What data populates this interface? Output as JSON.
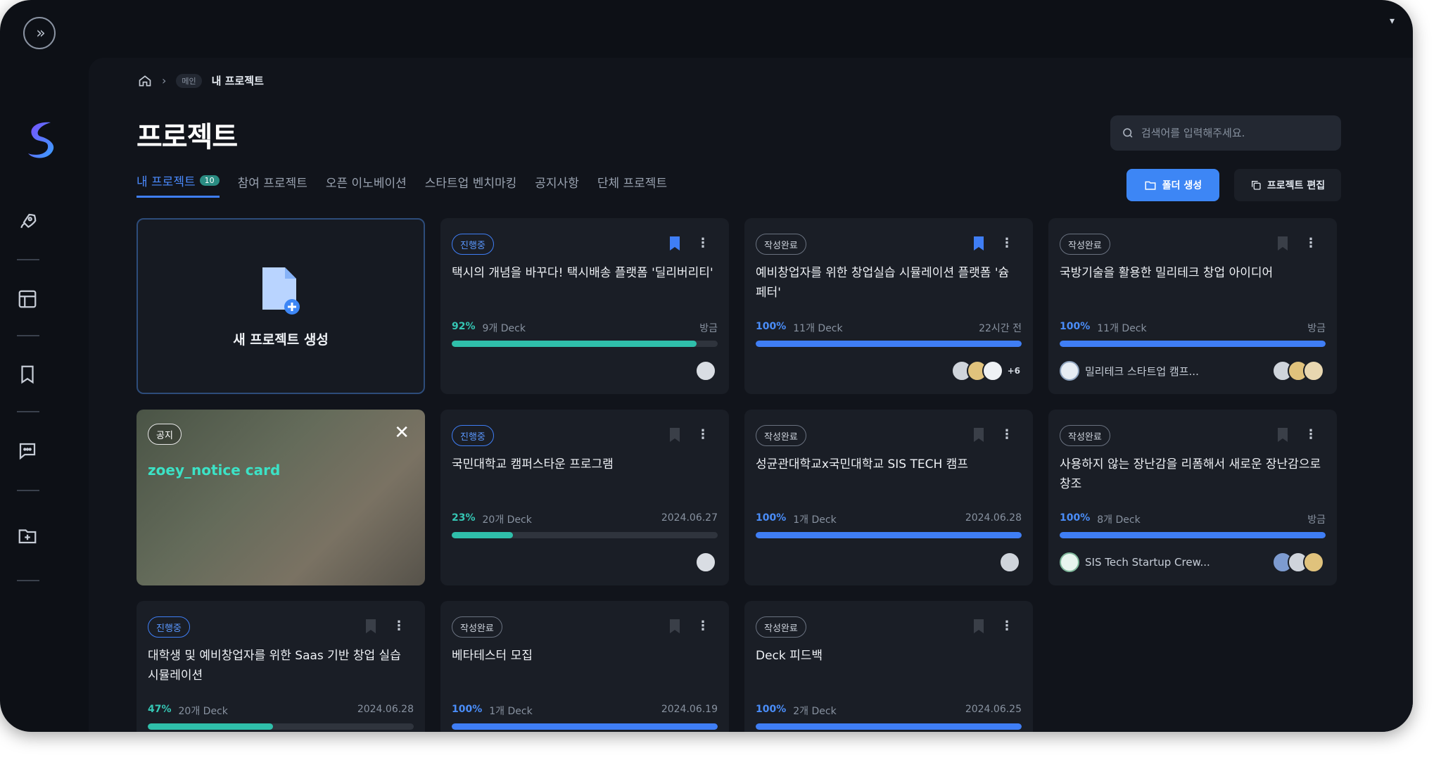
{
  "breadcrumb": {
    "pill": "메인",
    "current": "내 프로젝트"
  },
  "page_title": "프로젝트",
  "search": {
    "placeholder": "검색어를 입력해주세요."
  },
  "tabs": [
    {
      "label": "내 프로젝트",
      "badge": "10"
    },
    {
      "label": "참여 프로젝트"
    },
    {
      "label": "오픈 이노베이션"
    },
    {
      "label": "스타트업 벤치마킹"
    },
    {
      "label": "공지사항"
    },
    {
      "label": "단체 프로젝트"
    }
  ],
  "actions": {
    "folder": "폴더 생성",
    "edit": "프로젝트 편집"
  },
  "new_project": {
    "label": "새 프로젝트 생성"
  },
  "notice": {
    "tag": "공지",
    "name": "zoey_notice card"
  },
  "colors": {
    "accent": "#3f7ef5",
    "teal": "#2fbfaa",
    "background": "#11141b",
    "card": "#1a1e26"
  },
  "cards": [
    {
      "status": "진행중",
      "title": "택시의 개념을 바꾸다! 택시배송 플랫폼 '딜리버리티'",
      "percent": "92%",
      "progress": 0.92,
      "decks": "9개 Deck",
      "time": "방금",
      "bookmarked": true,
      "team": ""
    },
    {
      "status": "작성완료",
      "title": "예비창업자를 위한 창업실습 시뮬레이션 플랫폼 '슘페터'",
      "percent": "100%",
      "progress": 1.0,
      "decks": "11개 Deck",
      "time": "22시간 전",
      "bookmarked": true,
      "team": "",
      "more": "+6"
    },
    {
      "status": "작성완료",
      "title": "국방기술을 활용한 밀리테크 창업 아이디어",
      "percent": "100%",
      "progress": 1.0,
      "decks": "11개 Deck",
      "time": "방금",
      "bookmarked": false,
      "team": "밀리테크 스타트업 캠프..."
    },
    {
      "status": "진행중",
      "title": "국민대학교 캠퍼스타운 프로그램",
      "percent": "23%",
      "progress": 0.23,
      "decks": "20개 Deck",
      "time": "2024.06.27",
      "bookmarked": false,
      "team": ""
    },
    {
      "status": "작성완료",
      "title": "성균관대학교x국민대학교 SIS TECH 캠프",
      "percent": "100%",
      "progress": 1.0,
      "decks": "1개 Deck",
      "time": "2024.06.28",
      "bookmarked": false,
      "team": ""
    },
    {
      "status": "작성완료",
      "title": "사용하지 않는 장난감을 리폼해서 새로운 장난감으로 창조",
      "percent": "100%",
      "progress": 1.0,
      "decks": "8개 Deck",
      "time": "방금",
      "bookmarked": false,
      "team": "SIS Tech Startup Crew..."
    },
    {
      "status": "진행중",
      "title": "대학생 및 예비창업자를 위한 Saas 기반 창업 실습 시뮬레이션",
      "percent": "47%",
      "progress": 0.47,
      "decks": "20개 Deck",
      "time": "2024.06.28",
      "bookmarked": false,
      "team": ""
    },
    {
      "status": "작성완료",
      "title": "베타테스터 모집",
      "percent": "100%",
      "progress": 1.0,
      "decks": "1개 Deck",
      "time": "2024.06.19",
      "bookmarked": false,
      "team": ""
    },
    {
      "status": "작성완료",
      "title": "Deck 피드백",
      "percent": "100%",
      "progress": 1.0,
      "decks": "2개 Deck",
      "time": "2024.06.25",
      "bookmarked": false,
      "team": ""
    }
  ]
}
